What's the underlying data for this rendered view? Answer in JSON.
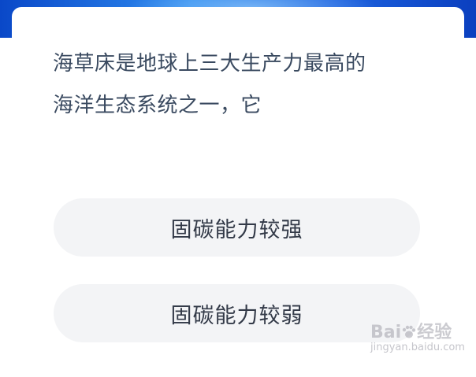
{
  "question": {
    "text_line1": "海草床是地球上三大生产力最高的",
    "text_line2": "海洋生态系统之一，它"
  },
  "options": [
    {
      "label": "固碳能力较强"
    },
    {
      "label": "固碳能力较弱"
    }
  ],
  "watermark": {
    "logo_text_left": "Bai",
    "logo_text_right": "经验",
    "url": "jingyan.baidu.com"
  },
  "colors": {
    "banner_blue": "#1d63e0",
    "question_text": "#3a4a60",
    "option_bg": "#f3f4f6",
    "option_text": "#333a48"
  }
}
